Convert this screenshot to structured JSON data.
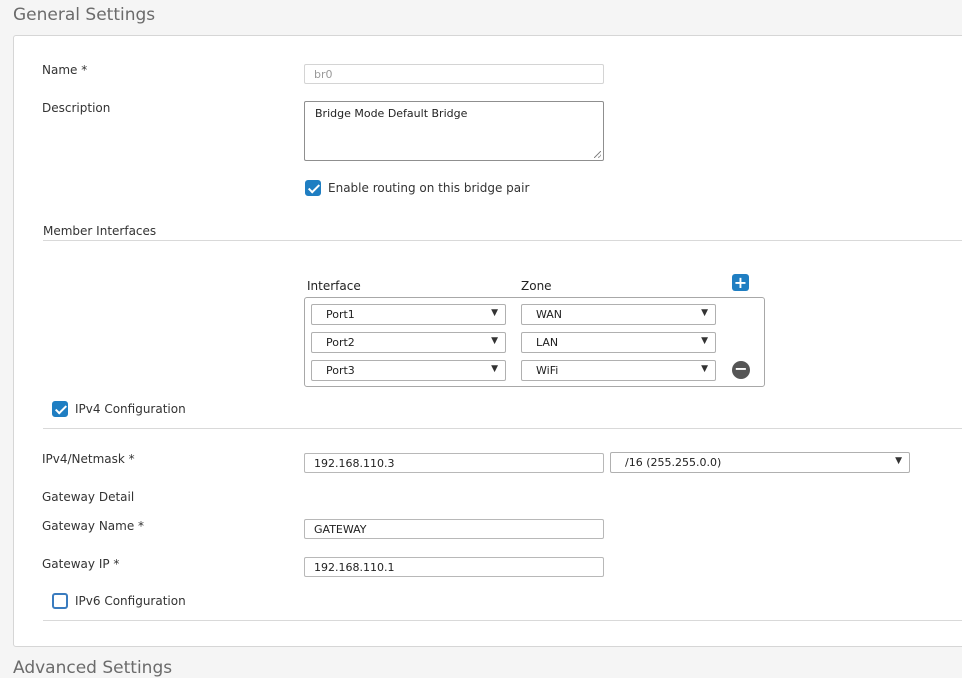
{
  "general": {
    "title": "General Settings"
  },
  "name": {
    "label": "Name *",
    "value": "br0"
  },
  "description": {
    "label": "Description",
    "value": "Bridge Mode Default Bridge"
  },
  "routing": {
    "label": "Enable routing on this bridge pair",
    "checked": true
  },
  "members": {
    "title": "Member Interfaces",
    "interface_header": "Interface",
    "zone_header": "Zone",
    "rows": [
      {
        "interface": "Port1",
        "zone": "WAN"
      },
      {
        "interface": "Port2",
        "zone": "LAN"
      },
      {
        "interface": "Port3",
        "zone": "WiFi"
      }
    ],
    "add_icon": "plus-icon",
    "remove_icon": "minus-circle-icon"
  },
  "ipv4": {
    "label": "IPv4 Configuration",
    "checked": true,
    "netmask_label": "IPv4/Netmask *",
    "ip_value": "192.168.110.3",
    "netmask_value": "/16 (255.255.0.0)"
  },
  "gateway": {
    "detail_label": "Gateway Detail",
    "name_label": "Gateway Name  *",
    "name_value": "GATEWAY",
    "ip_label": "Gateway IP  *",
    "ip_value": "192.168.110.1"
  },
  "ipv6": {
    "label": "IPv6 Configuration",
    "checked": false
  },
  "advanced": {
    "title": "Advanced Settings"
  },
  "colors": {
    "accent": "#1f7ec2",
    "border": "#d6d6d6"
  }
}
